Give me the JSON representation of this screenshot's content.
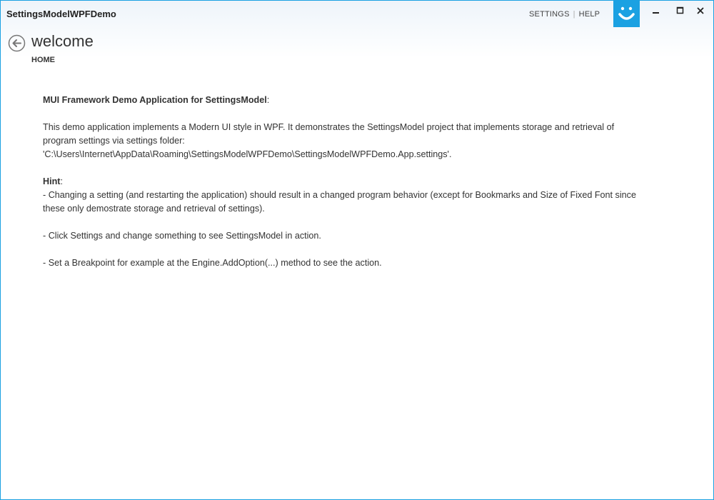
{
  "window": {
    "title": "SettingsModelWPFDemo",
    "links": {
      "settings": "SETTINGS",
      "help": "HELP"
    },
    "accent_color": "#1ba1e2"
  },
  "header": {
    "page_title": "welcome",
    "breadcrumb": "HOME"
  },
  "content": {
    "heading": "MUI Framework Demo Application for SettingsModel",
    "heading_suffix": ":",
    "intro_line1": "This demo application implements a Modern UI style in WPF. It demonstrates the SettingsModel project that implements storage and retrieval of",
    "intro_line2": "program settings via settings folder:",
    "path": "'C:\\Users\\Internet\\AppData\\Roaming\\SettingsModelWPFDemo\\SettingsModelWPFDemo.App.settings'.",
    "hint_label": "Hint",
    "hint_suffix": ":",
    "hint1_line1": "- Changing a setting (and restarting the application) should result in a changed program behavior (except for Bookmarks and Size of Fixed Font since",
    "hint1_line2": "these only demostrate storage and retrieval of settings).",
    "hint2": "- Click Settings and change something to see SettingsModel in action.",
    "hint3": "- Set a Breakpoint for example at the Engine.AddOption(...) method to see the action."
  },
  "icons": {
    "logo": "smiley-icon",
    "back": "back-arrow-icon",
    "minimize": "minimize-icon",
    "maximize": "maximize-icon",
    "close": "close-icon"
  }
}
